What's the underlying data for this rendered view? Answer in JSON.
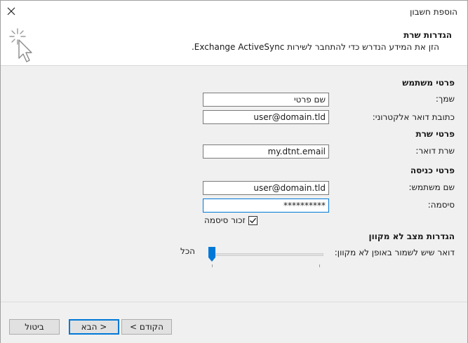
{
  "window": {
    "title": "הוספת חשבון"
  },
  "header": {
    "title": "הגדרות שרת",
    "description": "הזן את המידע הנדרש כדי להתחבר לשירות Exchange ActiveSync."
  },
  "user_section": {
    "title": "פרטי משתמש",
    "name_label": "שמך:",
    "name_value": "שם פרטי",
    "email_label": "כתובת דואר אלקטרוני:",
    "email_value": "user@domain.tld"
  },
  "server_section": {
    "title": "פרטי שרת",
    "server_label": "שרת דואר:",
    "server_value": "my.dtnt.email"
  },
  "login_section": {
    "title": "פרטי כניסה",
    "username_label": "שם משתמש:",
    "username_value": "user@domain.tld",
    "password_label": "סיסמה:",
    "password_value": "**********",
    "remember_label": "זכור סיסמה",
    "remember_checked": true
  },
  "offline_section": {
    "title": "הגדרות מצב לא מקוון",
    "mail_label": "דואר שיש לשמור באופן לא מקוון:",
    "slider_value_label": "הכל",
    "slider_level": 0
  },
  "footer": {
    "cancel_label": "ביטול",
    "next_label": "הבא >",
    "back_label": "< הקודם"
  },
  "colors": {
    "accent": "#0078d7",
    "content_bg": "#f0f0f0"
  }
}
